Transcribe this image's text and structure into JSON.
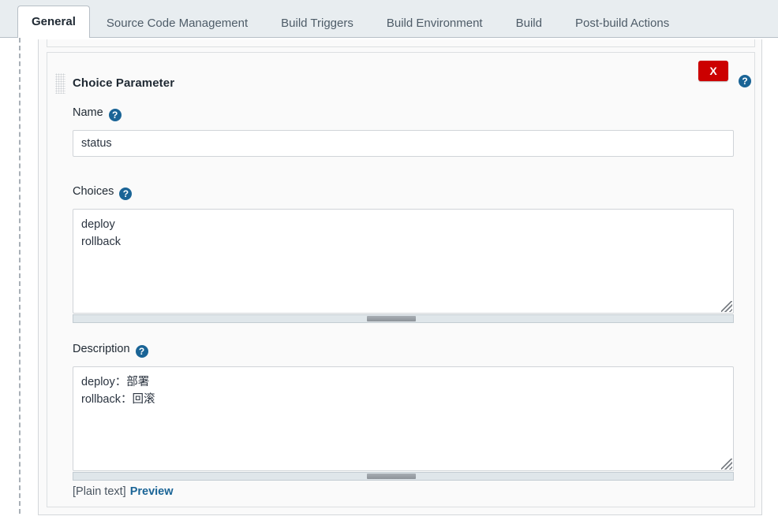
{
  "tabs": [
    {
      "label": "General",
      "active": true
    },
    {
      "label": "Source Code Management",
      "active": false
    },
    {
      "label": "Build Triggers",
      "active": false
    },
    {
      "label": "Build Environment",
      "active": false
    },
    {
      "label": "Build",
      "active": false
    },
    {
      "label": "Post-build Actions",
      "active": false
    }
  ],
  "parameter": {
    "title": "Choice Parameter",
    "delete_label": "X",
    "help_glyph": "?",
    "name": {
      "label": "Name",
      "value": "status"
    },
    "choices": {
      "label": "Choices",
      "value": "deploy\nrollback"
    },
    "description": {
      "label": "Description",
      "value": "deploy：部署\nrollback：回滚",
      "markup_note": "[Plain text]",
      "preview_label": "Preview"
    }
  },
  "colors": {
    "accent_blue": "#1a6496",
    "delete_red": "#cc0000",
    "tabbar_bg": "#e8edf0",
    "panel_bg": "#fafafa",
    "border": "#dcdfe2"
  }
}
